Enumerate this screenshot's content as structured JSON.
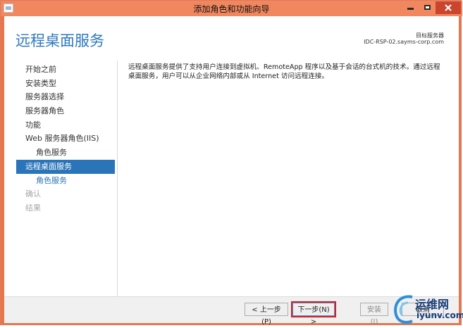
{
  "window": {
    "title": "添加角色和功能向导"
  },
  "header": {
    "page_title": "远程桌面服务",
    "target_label": "目标服务器",
    "target_value": "IDC-RSP-02.sayms-corp.com"
  },
  "nav": {
    "items": [
      {
        "label": "开始之前"
      },
      {
        "label": "安装类型"
      },
      {
        "label": "服务器选择"
      },
      {
        "label": "服务器角色"
      },
      {
        "label": "功能"
      },
      {
        "label": "Web 服务器角色(IIS)"
      },
      {
        "label": "角色服务"
      },
      {
        "label": "远程桌面服务"
      },
      {
        "label": "角色服务"
      },
      {
        "label": "确认"
      },
      {
        "label": "结果"
      }
    ]
  },
  "main": {
    "description": "远程桌面服务提供了支持用户连接到虚拟机、RemoteApp 程序以及基于会话的台式机的技术。通过远程桌面服务，用户可以从企业网络内部或从 Internet 访问远程连接。"
  },
  "footer": {
    "prev_label": "< 上一步(P)",
    "next_label": "下一步(N) >",
    "install_label": "安装(I)",
    "cancel_label": "取消"
  },
  "watermark": {
    "line1": "运维网",
    "line2": "iyunv.com"
  },
  "colors": {
    "accent": "#2a74b9",
    "titlebar": "#f0875f",
    "highlight_border": "#d42020"
  }
}
